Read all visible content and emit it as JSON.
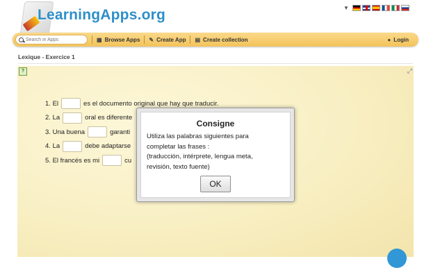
{
  "header": {
    "logo_text": "LearningApps.org",
    "flags": [
      "german-flag",
      "english-flag",
      "spanish-flag",
      "french-flag",
      "italian-flag",
      "russian-flag"
    ]
  },
  "navbar": {
    "search_placeholder": "Search in Apps",
    "browse_label": "Browse Apps",
    "create_label": "Create App",
    "collection_label": "Create collection",
    "login_label": "Login"
  },
  "page": {
    "title": "Lexique - Exercice 1"
  },
  "exercise": {
    "rows": [
      {
        "num": "1.",
        "before": "El",
        "after": "es el documento original que hay que traducir."
      },
      {
        "num": "2.",
        "before": "La",
        "after": "oral es diferente"
      },
      {
        "num": "3.",
        "before": "Una buena",
        "after": "garanti"
      },
      {
        "num": "4.",
        "before": "La",
        "after": "debe adaptarse"
      },
      {
        "num": "5.",
        "before": "El francés es mi",
        "after": "cu"
      }
    ]
  },
  "dialog": {
    "title": "Consigne",
    "line1": "Utiliza las palabras siguientes para",
    "line2": "completar las frases :",
    "line3": "(traducción, intérprete, lengua meta,",
    "line4": "revisión, texto fuente)",
    "ok_label": "OK"
  },
  "colors": {
    "navbar": "#f3c35a",
    "logo": "#2e8fc9",
    "app_background": "#f8efc3"
  }
}
